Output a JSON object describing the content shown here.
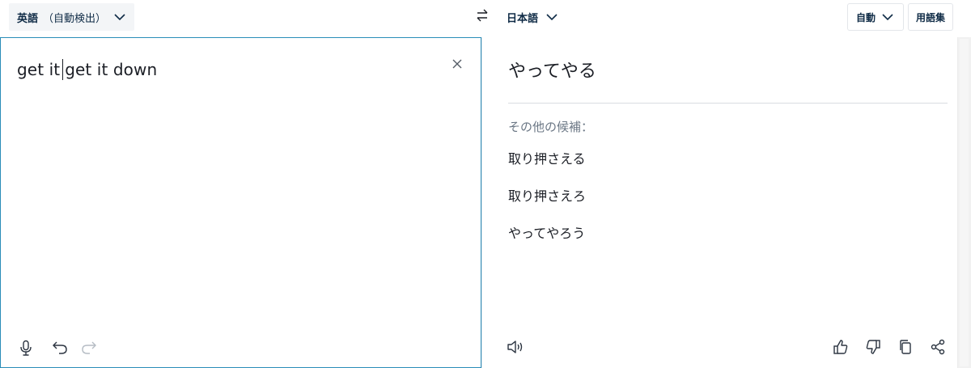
{
  "source_lang": {
    "name": "英語",
    "detect_label": "（自動検出）"
  },
  "target_lang": {
    "name": "日本語"
  },
  "formality": {
    "label": "自動"
  },
  "glossary": {
    "label": "用語集"
  },
  "source": {
    "text_before_caret": "get it",
    "text_after_caret": "get it down"
  },
  "target": {
    "main_translation": "やってやる",
    "alternatives_heading": "その他の候補：",
    "alternatives": [
      "取り押さえる",
      "取り押さえろ",
      "やってやろう"
    ]
  },
  "colors": {
    "accent_border": "#2a8db8",
    "text": "#1b1e25",
    "muted": "#6b7785"
  },
  "icons": {
    "src_dropdown": "chevron-down-icon",
    "swap": "swap-arrows-icon",
    "clear": "close-icon",
    "mic": "microphone-icon",
    "undo": "undo-icon",
    "redo": "redo-icon",
    "speaker": "speaker-icon",
    "like": "thumbs-up-icon",
    "dislike": "thumbs-down-icon",
    "copy": "copy-icon",
    "share": "share-icon"
  }
}
